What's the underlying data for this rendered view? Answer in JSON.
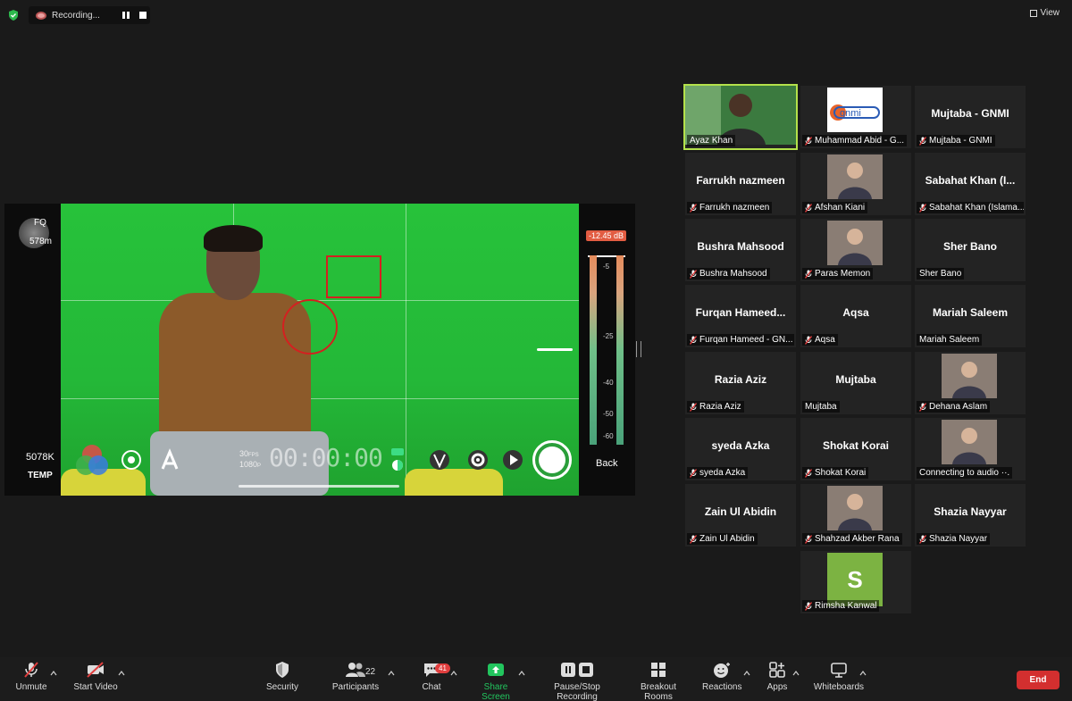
{
  "topbar": {
    "recording_label": "Recording...",
    "view_label": "View",
    "colors": {
      "security_shield": "#2db84d"
    }
  },
  "camera_view": {
    "fq_label": "FQ",
    "fq_value": "578m",
    "temp_value": "5078K",
    "temp_label": "TEMP",
    "db_level": "-12.45 dB",
    "meter_ticks": [
      "-5",
      "-25",
      "-40",
      "-50",
      "-60"
    ],
    "back_label": "Back",
    "fps_label": "30",
    "fps_unit": "FPS",
    "resolution_label": "1080",
    "resolution_unit": "P",
    "timer": "00:00:00"
  },
  "gallery": [
    {
      "label": "Ayaz Khan",
      "muted": false,
      "type": "video",
      "active": true
    },
    {
      "label": "Muhammad Abid - G...",
      "muted": true,
      "type": "logo"
    },
    {
      "name": "Mujtaba - GNMI",
      "label": "Mujtaba - GNMI",
      "muted": true,
      "type": "name"
    },
    {
      "name": "Farrukh nazmeen",
      "label": "Farrukh nazmeen",
      "muted": true,
      "type": "name"
    },
    {
      "label": "Afshan Kiani",
      "muted": true,
      "type": "photo"
    },
    {
      "name": "Sabahat Khan (I...",
      "label": "Sabahat Khan (Islama...",
      "muted": true,
      "type": "name"
    },
    {
      "name": "Bushra Mahsood",
      "label": "Bushra Mahsood",
      "muted": true,
      "type": "name"
    },
    {
      "label": "Paras Memon",
      "muted": true,
      "type": "photo"
    },
    {
      "name": "Sher Bano",
      "label": "Sher Bano",
      "muted": false,
      "type": "name"
    },
    {
      "name": "Furqan  Hameed...",
      "label": "Furqan Hameed - GN...",
      "muted": true,
      "type": "name"
    },
    {
      "name": "Aqsa",
      "label": "Aqsa",
      "muted": true,
      "type": "name"
    },
    {
      "name": "Mariah Saleem",
      "label": "Mariah Saleem",
      "muted": false,
      "type": "name"
    },
    {
      "name": "Razia Aziz",
      "label": "Razia Aziz",
      "muted": true,
      "type": "name"
    },
    {
      "name": "Mujtaba",
      "label": "Mujtaba",
      "muted": false,
      "type": "name"
    },
    {
      "label": "Dehana Aslam",
      "muted": true,
      "type": "photo"
    },
    {
      "name": "syeda Azka",
      "label": "syeda Azka",
      "muted": true,
      "type": "name"
    },
    {
      "name": "Shokat Korai",
      "label": "Shokat Korai",
      "muted": true,
      "type": "name"
    },
    {
      "label": "Connecting to audio ··.",
      "muted": false,
      "type": "photo"
    },
    {
      "name": "Zain Ul Abidin",
      "label": "Zain Ul Abidin",
      "muted": true,
      "type": "name"
    },
    {
      "label": "Shahzad Akber Rana",
      "muted": true,
      "type": "photo"
    },
    {
      "name": "Shazia  Nayyar",
      "label": "Shazia  Nayyar",
      "muted": true,
      "type": "name"
    },
    {
      "label": "Rimsha Kanwal",
      "muted": true,
      "type": "avatar",
      "avatar_letter": "S"
    }
  ],
  "toolbar": {
    "unmute": "Unmute",
    "start_video": "Start Video",
    "security": "Security",
    "participants": "Participants",
    "participants_count": "22",
    "chat": "Chat",
    "chat_badge": "41",
    "share_screen": "Share Screen",
    "pause_stop_recording": "Pause/Stop Recording",
    "breakout_rooms": "Breakout Rooms",
    "reactions": "Reactions",
    "apps": "Apps",
    "whiteboards": "Whiteboards",
    "end": "End",
    "colors": {
      "share_screen": "#22c55e",
      "end": "#d32f2f",
      "chat_badge": "#e03e3e"
    }
  }
}
